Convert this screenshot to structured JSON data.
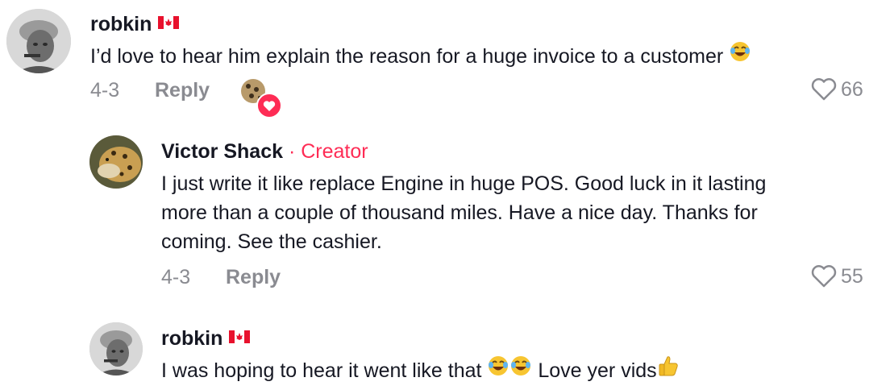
{
  "comments": [
    {
      "username": "robkin",
      "text": "I’d love to hear him explain the reason for a huge invoice to a customer",
      "date": "4-3",
      "reply_label": "Reply",
      "likes": "66",
      "flag": "canada-flag",
      "emoji": "joy-emoji",
      "creator_liked": true
    },
    {
      "username": "Victor Shack",
      "separator": "·",
      "creator_label": "Creator",
      "text_lines": [
        "I just write it like replace Engine in huge POS. Good luck in it lasting",
        "more than a couple of thousand miles. Have a nice day. Thanks for",
        "coming. See the cashier."
      ],
      "date": "4-3",
      "reply_label": "Reply",
      "likes": "55"
    },
    {
      "username": "robkin",
      "text_a": "I was hoping to hear it went like that",
      "text_b": "Love yer vids",
      "flag": "canada-flag"
    }
  ],
  "colors": {
    "accent": "#fe2c55",
    "muted": "#8a8b91",
    "text": "#161823"
  }
}
